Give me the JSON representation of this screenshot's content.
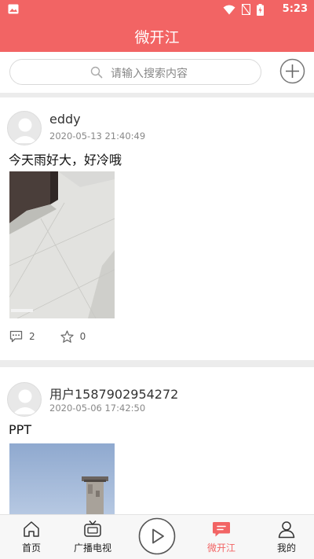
{
  "status_bar": {
    "time": "5:23",
    "icons": [
      "image-notification-icon",
      "wifi-icon",
      "no-signal-icon",
      "battery-charging-icon"
    ]
  },
  "header": {
    "title": "微开江"
  },
  "search": {
    "placeholder": "请输入搜索内容",
    "icon": "search-icon",
    "add_icon": "add-circle-icon"
  },
  "posts": [
    {
      "username": "eddy",
      "time": "2020-05-13 21:40:49",
      "text": "今天雨好大，好冷哦",
      "comments": "2",
      "likes": "0"
    },
    {
      "username": "用户1587902954272",
      "time": "2020-05-06 17:42:50",
      "text": "PPT"
    }
  ],
  "tabs": [
    {
      "label": "首页",
      "icon": "home-icon"
    },
    {
      "label": "广播电视",
      "icon": "tv-icon"
    },
    {
      "label": "",
      "icon": "play-icon"
    },
    {
      "label": "微开江",
      "icon": "chat-icon",
      "active": true
    },
    {
      "label": "我的",
      "icon": "user-icon"
    }
  ],
  "colors": {
    "accent": "#f26464",
    "divider": "#ececec"
  }
}
